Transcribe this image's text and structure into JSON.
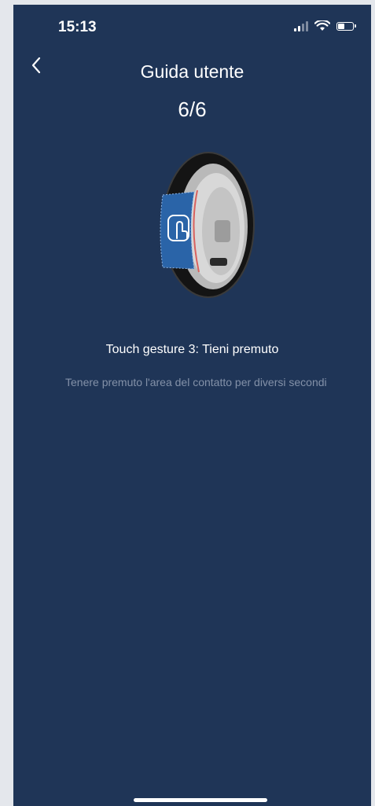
{
  "status_bar": {
    "time": "15:13",
    "icons": [
      "cellular-signal-icon",
      "wifi-icon",
      "battery-icon"
    ],
    "battery_level": 0.45
  },
  "header": {
    "back_icon": "chevron-left-icon",
    "title": "Guida utente"
  },
  "guide": {
    "step": "6/6",
    "illustration_icon": "touch-finger-icon",
    "gesture_title": "Touch gesture 3: Tieni premuto",
    "gesture_description": "Tenere premuto l'area del contatto  per diversi secondi"
  },
  "colors": {
    "background": "#1f3557",
    "text": "#ffffff",
    "secondary_text": "#8391a8",
    "touch_area": "#2a64a8"
  }
}
